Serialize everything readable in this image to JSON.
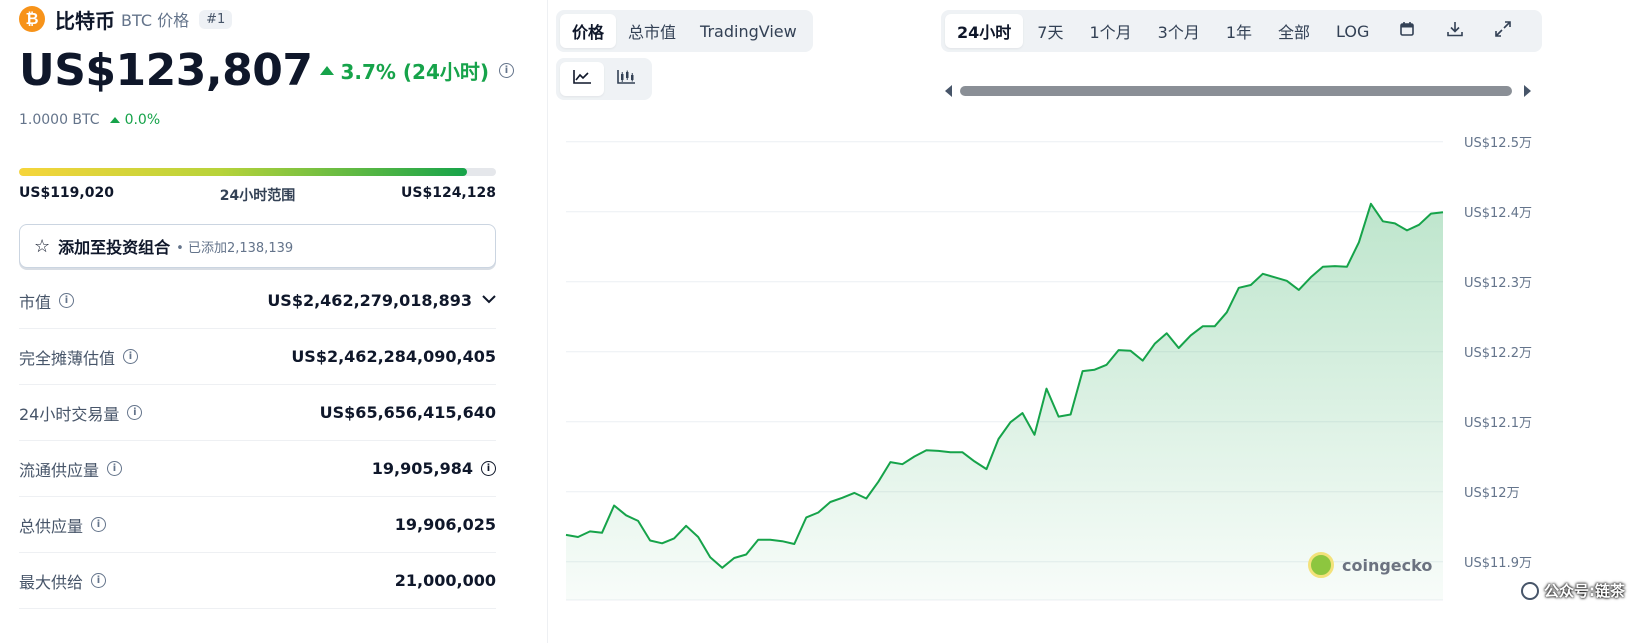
{
  "coin": {
    "logo_letter": "₿",
    "name": "比特币",
    "symbol_label": "BTC 价格",
    "rank": "#1",
    "price": "US$123,807",
    "change_24h": "3.7% (24小时)",
    "btc_value": "1.0000 BTC",
    "btc_change": "0.0%"
  },
  "range_24h": {
    "low": "US$119,020",
    "label": "24小时范围",
    "high": "US$124,128",
    "position": 0.94
  },
  "portfolio": {
    "label": "添加至投资组合",
    "count_text": "已添加2,138,139"
  },
  "stats": [
    {
      "label": "市值",
      "value": "US$2,462,279,018,893"
    },
    {
      "label": "完全摊薄估值",
      "value": "US$2,462,284,090,405"
    },
    {
      "label": "24小时交易量",
      "value": "US$65,656,415,640"
    },
    {
      "label": "流通供应量",
      "value": "19,905,984"
    },
    {
      "label": "总供应量",
      "value": "19,906,025"
    },
    {
      "label": "最大供给",
      "value": "21,000,000"
    }
  ],
  "chart_tabs": [
    "价格",
    "总市值",
    "TradingView"
  ],
  "active_chart_tab": "价格",
  "time_ranges": [
    "24小时",
    "7天",
    "1个月",
    "3个月",
    "1年",
    "全部",
    "LOG"
  ],
  "active_time_range": "24小时",
  "icons": {
    "calendar": "calendar-icon",
    "download": "download-icon",
    "expand": "expand-icon",
    "line_chart": "line-chart-icon",
    "candle_chart": "candlestick-chart-icon"
  },
  "watermark": "coingecko",
  "credit": "公众号:链茶",
  "colors": {
    "line": "#16a34a",
    "up": "#16a34a",
    "brand": "#f7931a"
  },
  "chart_data": {
    "type": "area",
    "title": "",
    "xlabel": "",
    "ylabel": "",
    "y_tick_labels": [
      "US$12.5万",
      "US$12.4万",
      "US$12.3万",
      "US$12.2万",
      "US$12.1万",
      "US$12万",
      "US$11.9万"
    ],
    "y_ticks": [
      125000,
      124000,
      123000,
      122000,
      121000,
      120000,
      119000
    ],
    "ylim": [
      118000,
      125000
    ],
    "grid": true,
    "series": [
      {
        "values": [
          119370,
          119340,
          119420,
          119400,
          119790,
          119650,
          119570,
          119290,
          119250,
          119320,
          119500,
          119340,
          119050,
          118900,
          119040,
          119090,
          119300,
          119300,
          119280,
          119240,
          119620,
          119690,
          119840,
          119900,
          119970,
          119890,
          120130,
          120410,
          120380,
          120490,
          120580,
          120570,
          120550,
          120550,
          120420,
          120310,
          120740,
          120980,
          121110,
          120800,
          121460,
          121060,
          121090,
          121710,
          121730,
          121800,
          122010,
          122000,
          121860,
          122100,
          122250,
          122040,
          122220,
          122350,
          122350,
          122550,
          122900,
          122940,
          123100,
          123050,
          123000,
          122870,
          123050,
          123200,
          123210,
          123200,
          123550,
          124100,
          123850,
          123820,
          123720,
          123800,
          123960,
          123980
        ]
      }
    ]
  }
}
